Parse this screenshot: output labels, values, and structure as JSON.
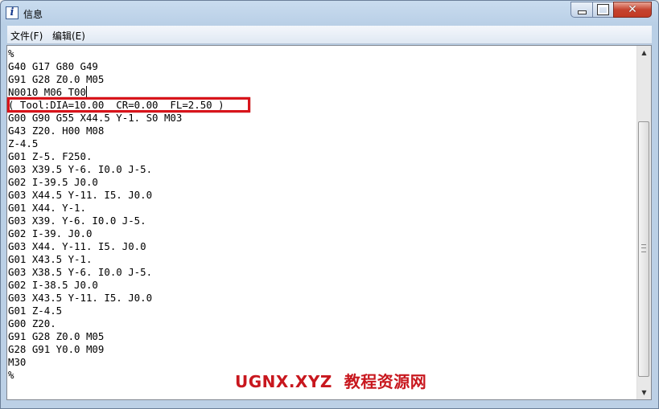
{
  "window": {
    "title": "信息",
    "app_icon": "info-icon",
    "accent": "#c8171e"
  },
  "menu": {
    "file": "文件(F)",
    "edit": "编辑(E)"
  },
  "code_lines": [
    "%",
    "G40 G17 G80 G49",
    "G91 G28 Z0.0 M05",
    "N0010 M06 T00",
    "( Tool:DIA=10.00  CR=0.00  FL=2.50 )",
    "G00 G90 G55 X44.5 Y-1. S0 M03",
    "G43 Z20. H00 M08",
    "Z-4.5",
    "G01 Z-5. F250.",
    "G03 X39.5 Y-6. I0.0 J-5.",
    "G02 I-39.5 J0.0",
    "G03 X44.5 Y-11. I5. J0.0",
    "G01 X44. Y-1.",
    "G03 X39. Y-6. I0.0 J-5.",
    "G02 I-39. J0.0",
    "G03 X44. Y-11. I5. J0.0",
    "G01 X43.5 Y-1.",
    "G03 X38.5 Y-6. I0.0 J-5.",
    "G02 I-38.5 J0.0",
    "G03 X43.5 Y-11. I5. J0.0",
    "G01 Z-4.5",
    "G00 Z20.",
    "G91 G28 Z0.0 M05",
    "G28 G91 Y0.0 M09",
    "M30",
    "%"
  ],
  "watermark": "UGNX.XYZ  教程资源网"
}
